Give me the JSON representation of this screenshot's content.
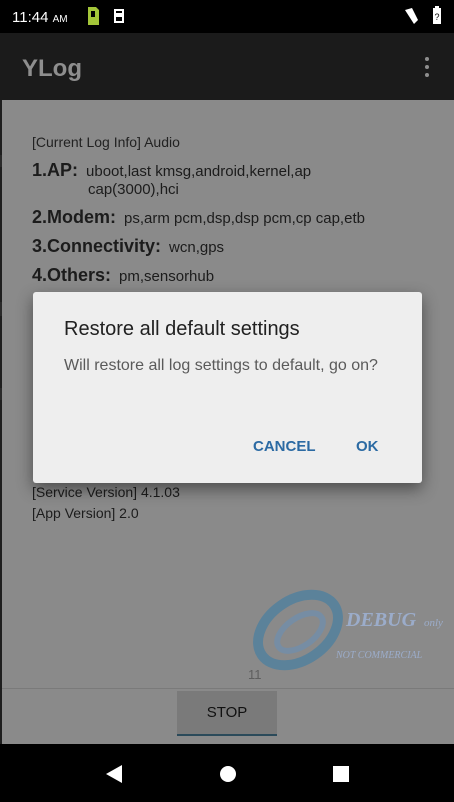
{
  "status_bar": {
    "time": "11:44",
    "ampm": "AM"
  },
  "app_bar": {
    "title": "YLog"
  },
  "log_info": {
    "header": "[Current Log Info] Audio",
    "rows": [
      {
        "label": "1.AP:",
        "value": "uboot,last kmsg,android,kernel,ap",
        "value2": "cap(3000),hci"
      },
      {
        "label": "2.Modem:",
        "value": "ps,arm pcm,dsp,dsp pcm,cp cap,etb"
      },
      {
        "label": "3.Connectivity:",
        "value": "wcn,gps"
      },
      {
        "label": "4.Others:",
        "value": "pm,sensorhub"
      }
    ]
  },
  "versions": {
    "service": "[Service Version]  4.1.03",
    "app": "[App Version]  2.0"
  },
  "watermark": {
    "line1": "DEBUG",
    "line1b": "only",
    "line2": "NOT COMMERCIAL"
  },
  "page_count": "11",
  "stop_label": "STOP",
  "dialog": {
    "title": "Restore all default settings",
    "message": "Will restore all log settings to default, go on?",
    "cancel": "CANCEL",
    "ok": "OK"
  },
  "colors": {
    "accent": "#2b6aa3",
    "dialog_bg": "#eeeeee",
    "content_bg": "#8a8a8a"
  },
  "icons": [
    "sd-card-icon",
    "usb-debug-icon",
    "signal-icon",
    "battery-icon",
    "menu-dots-icon",
    "back-icon",
    "home-icon",
    "recents-icon"
  ]
}
